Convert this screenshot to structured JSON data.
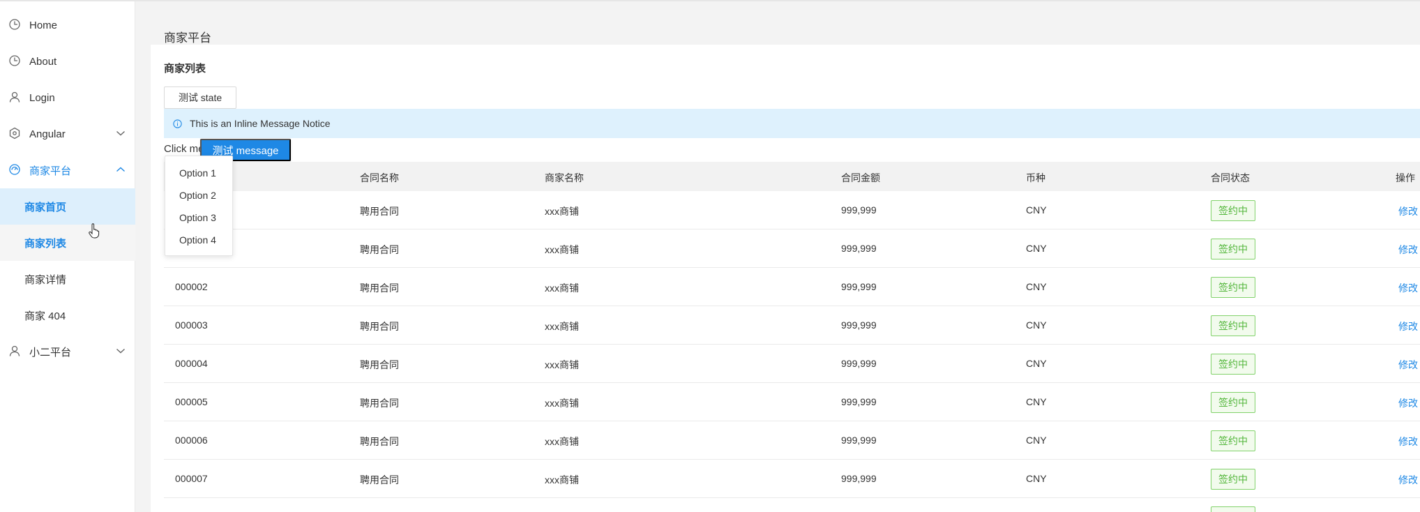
{
  "sidebar": {
    "items": [
      {
        "label": "Home",
        "icon": "clock-icon"
      },
      {
        "label": "About",
        "icon": "clock-icon"
      },
      {
        "label": "Login",
        "icon": "user-icon"
      },
      {
        "label": "Angular",
        "icon": "hexagon-icon"
      },
      {
        "label": "商家平台",
        "icon": "dashboard-icon"
      },
      {
        "label": "小二平台",
        "icon": "user-icon"
      }
    ],
    "merchant_sub": [
      {
        "label": "商家首页"
      },
      {
        "label": "商家列表"
      },
      {
        "label": "商家详情"
      },
      {
        "label": "商家 404"
      }
    ]
  },
  "page": {
    "title": "商家平台",
    "card_title": "商家列表",
    "state_button": "测试 state",
    "notice": "This is an Inline Message Notice",
    "click_text": "Click me",
    "message_button": "测试 message"
  },
  "dropdown": {
    "options": [
      "Option 1",
      "Option 2",
      "Option 3",
      "Option 4"
    ]
  },
  "table": {
    "columns": [
      "合同名称",
      "商家名称",
      "合同金额",
      "币种",
      "合同状态",
      "操作"
    ],
    "rows": [
      {
        "id": "",
        "contract": "聘用合同",
        "merchant": "xxx商铺",
        "amount": "999,999",
        "currency": "CNY",
        "status": "签约中",
        "action": "修改"
      },
      {
        "id": "",
        "contract": "聘用合同",
        "merchant": "xxx商铺",
        "amount": "999,999",
        "currency": "CNY",
        "status": "签约中",
        "action": "修改"
      },
      {
        "id": "000002",
        "contract": "聘用合同",
        "merchant": "xxx商铺",
        "amount": "999,999",
        "currency": "CNY",
        "status": "签约中",
        "action": "修改"
      },
      {
        "id": "000003",
        "contract": "聘用合同",
        "merchant": "xxx商铺",
        "amount": "999,999",
        "currency": "CNY",
        "status": "签约中",
        "action": "修改"
      },
      {
        "id": "000004",
        "contract": "聘用合同",
        "merchant": "xxx商铺",
        "amount": "999,999",
        "currency": "CNY",
        "status": "签约中",
        "action": "修改"
      },
      {
        "id": "000005",
        "contract": "聘用合同",
        "merchant": "xxx商铺",
        "amount": "999,999",
        "currency": "CNY",
        "status": "签约中",
        "action": "修改"
      },
      {
        "id": "000006",
        "contract": "聘用合同",
        "merchant": "xxx商铺",
        "amount": "999,999",
        "currency": "CNY",
        "status": "签约中",
        "action": "修改"
      },
      {
        "id": "000007",
        "contract": "聘用合同",
        "merchant": "xxx商铺",
        "amount": "999,999",
        "currency": "CNY",
        "status": "签约中",
        "action": "修改"
      }
    ]
  },
  "colors": {
    "accent": "#1e88e5",
    "tag_green": "#52b63a",
    "notice_bg": "#def1fd"
  }
}
